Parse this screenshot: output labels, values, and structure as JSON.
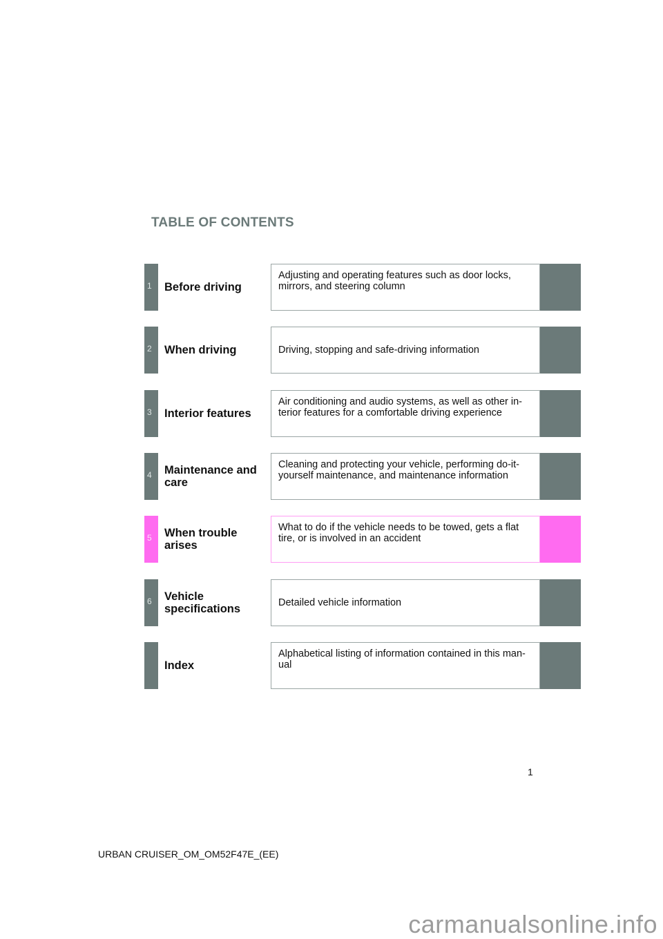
{
  "page": {
    "title": "TABLE OF CONTENTS",
    "page_number": "1",
    "footer": "URBAN CRUISER_OM_OM52F47E_(EE)",
    "watermark": "carmanualsonline.info"
  },
  "colors": {
    "section_gray": "#6b7a79",
    "active_pink": "#ff6bf0"
  },
  "sections": [
    {
      "number": "1",
      "label": "Before driving",
      "description": "Adjusting and operating features such as door locks, mirrors, and steering column",
      "active": false
    },
    {
      "number": "2",
      "label": "When driving",
      "description": "Driving, stopping and safe-driving information",
      "active": false
    },
    {
      "number": "3",
      "label": "Interior features",
      "description": "Air conditioning and audio systems, as well as other in-terior features for a comfortable driving experience",
      "active": false
    },
    {
      "number": "4",
      "label": "Maintenance and care",
      "description": "Cleaning and protecting your vehicle, performing do-it-yourself maintenance, and maintenance information",
      "active": false
    },
    {
      "number": "5",
      "label": "When trouble arises",
      "description": "What to do if the vehicle needs to be towed, gets a flat tire, or is involved in an accident",
      "active": true
    },
    {
      "number": "6",
      "label": "Vehicle specifications",
      "description": "Detailed vehicle information",
      "active": false
    },
    {
      "number": "",
      "label": "Index",
      "description": "Alphabetical listing of information contained in this man-ual",
      "active": false
    }
  ]
}
